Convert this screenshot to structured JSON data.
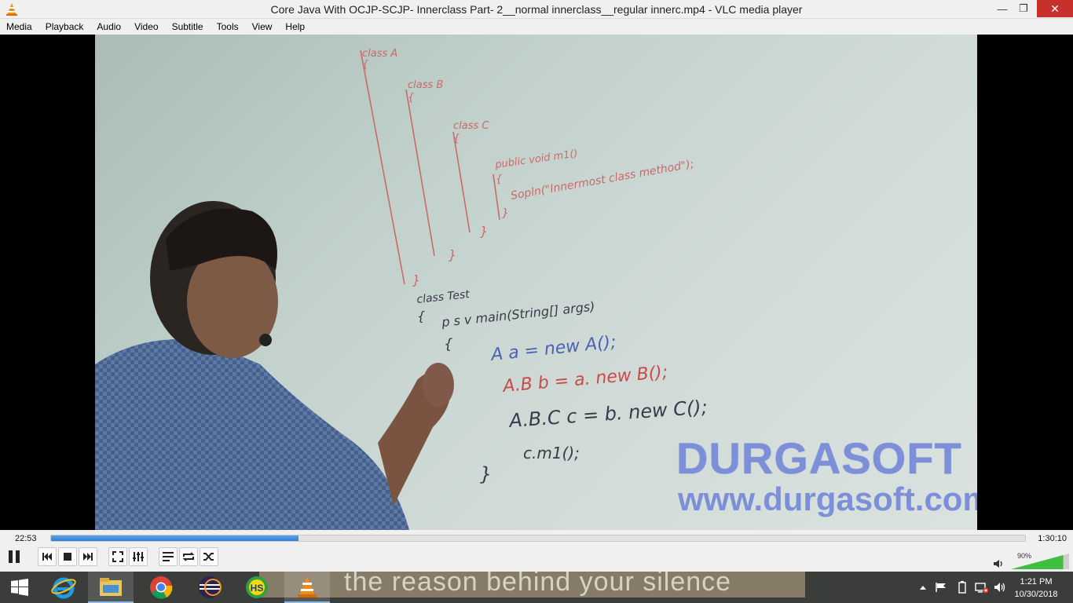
{
  "window": {
    "title": "Core Java With OCJP-SCJP- Innerclass  Part- 2__normal innerclass__regular innerc.mp4 - VLC media player",
    "minimize": "—",
    "maximize": "❐",
    "close": "✕"
  },
  "menu": [
    "Media",
    "Playback",
    "Audio",
    "Video",
    "Subtitle",
    "Tools",
    "View",
    "Help"
  ],
  "video": {
    "whiteboard_code": [
      "class A",
      "{",
      "class B",
      "{",
      "class C",
      "{",
      "public void m1()",
      "{",
      "Sopln(\"Innermost class method\");",
      "}",
      "}",
      "}",
      "}",
      "class Test",
      "{",
      "p s v main(String[] args)",
      "{",
      "A   a = new   A();",
      "A.B   b = a. new  B();",
      "A.B.C   c = b. new  C();",
      "c.m1();",
      "}"
    ],
    "watermark_title": "DURGASOFT",
    "watermark_url": "www.durgasoft.com"
  },
  "playback": {
    "elapsed": "22:53",
    "total": "1:30:10",
    "progress_fraction": 0.254,
    "volume_label": "90%",
    "volume_fraction": 0.9
  },
  "colors": {
    "accent": "#2f7fd6",
    "close_button": "#c7302b",
    "volume_green": "#3fbf3f"
  },
  "taskbar": {
    "banner_text": "the reason behind your silence",
    "apps": [
      "windows-start-icon",
      "internet-explorer-icon",
      "file-explorer-icon",
      "chrome-icon",
      "eclipse-icon",
      "hs-icon",
      "vlc-icon"
    ],
    "hs_label": "HS",
    "clock_time": "1:21 PM",
    "clock_date": "10/30/2018"
  }
}
